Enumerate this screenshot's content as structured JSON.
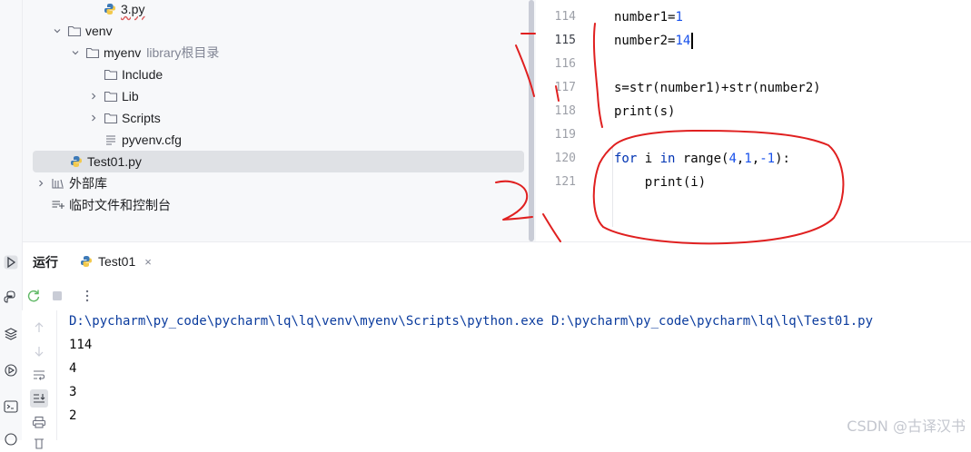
{
  "colors": {
    "accent": "#3574f0",
    "annotation": "#e02020",
    "keyword": "#0033b3",
    "number": "#1750eb"
  },
  "tree": {
    "items": [
      {
        "label": "3.py",
        "icon": "python-file-icon"
      },
      {
        "label": "venv",
        "icon": "folder-icon",
        "chevron": "chevron-down-icon"
      },
      {
        "label": "myenv",
        "hint": "library根目录",
        "icon": "folder-icon",
        "chevron": "chevron-down-icon"
      },
      {
        "label": "Include",
        "icon": "folder-icon"
      },
      {
        "label": "Lib",
        "icon": "folder-icon",
        "chevron": "chevron-right-icon"
      },
      {
        "label": "Scripts",
        "icon": "folder-icon",
        "chevron": "chevron-right-icon"
      },
      {
        "label": "pyvenv.cfg",
        "icon": "config-file-icon"
      },
      {
        "label": "Test01.py",
        "icon": "python-file-icon",
        "selected": true
      },
      {
        "label": "外部库",
        "icon": "library-icon",
        "chevron": "chevron-right-icon"
      },
      {
        "label": "临时文件和控制台",
        "icon": "scratches-icon"
      }
    ]
  },
  "editor": {
    "line_numbers": [
      "114",
      "115",
      "116",
      "117",
      "118",
      "119",
      "120",
      "121"
    ],
    "current_line": "115",
    "lines": {
      "l114_a": "number1=",
      "l114_b": "1",
      "l115_a": "number2=",
      "l115_b": "14",
      "l117": "s=str(number1)+str(number2)",
      "l118": "print(s)",
      "l120_kw1": "for",
      "l120_a": " i ",
      "l120_kw2": "in",
      "l120_b": " range(",
      "l120_n1": "4",
      "l120_c1": ",",
      "l120_n2": "1",
      "l120_c2": ",",
      "l120_n3": "-1",
      "l120_end": "):",
      "l121": "    print(i)"
    }
  },
  "run": {
    "title": "运行",
    "tab_label": "Test01",
    "close_glyph": "×",
    "console": [
      "D:\\pycharm\\py_code\\pycharm\\lq\\lq\\venv\\myenv\\Scripts\\python.exe D:\\pycharm\\py_code\\pycharm\\lq\\lq\\Test01.py",
      "114",
      "4",
      "3",
      "2"
    ]
  },
  "watermark": "CSDN @古译汉书"
}
